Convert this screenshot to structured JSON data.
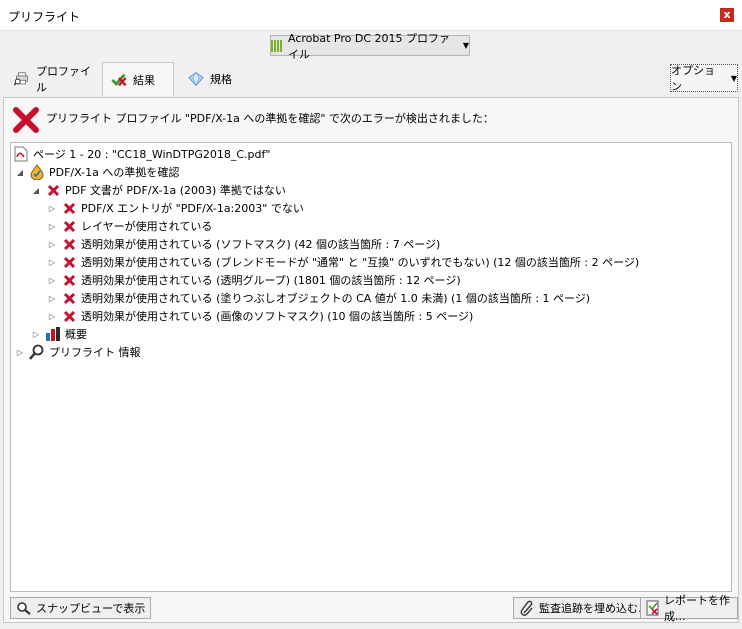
{
  "window": {
    "title": "プリフライト",
    "close_label": "x"
  },
  "profile_dropdown": {
    "label": "Acrobat Pro DC 2015 プロファイル",
    "accent": "#7cb030"
  },
  "tabs": [
    {
      "label": "プロファイル",
      "icon": "printer-magnifier-icon"
    },
    {
      "label": "結果",
      "icon": "check-cross-icon"
    },
    {
      "label": "規格",
      "icon": "diamond-icon"
    }
  ],
  "options": {
    "label": "オプション"
  },
  "message": {
    "text": "プリフライト プロファイル \"PDF/X-1a への準拠を確認\" で次のエラーが検出されました："
  },
  "tree": [
    {
      "label": "ページ 1 - 20 : \"CC18_WinDTPG2018_C.pdf\"",
      "icon": "pdf-file-icon"
    },
    {
      "label": "PDF/X-1a への準拠を確認",
      "icon": "preflight-droplet-icon"
    },
    {
      "label": "PDF 文書が PDF/X-1a (2003) 準拠ではない",
      "icon": "error-x-icon"
    },
    {
      "label": "PDF/X エントリが \"PDF/X-1a:2003\" でない",
      "icon": "error-x-icon"
    },
    {
      "label": "レイヤーが使用されている",
      "icon": "error-x-icon"
    },
    {
      "label": "透明効果が使用されている (ソフトマスク) (42 個の該当箇所 : 7 ページ)",
      "icon": "error-x-icon"
    },
    {
      "label": "透明効果が使用されている (ブレンドモードが \"通常\" と \"互換\" のいずれでもない) (12 個の該当箇所 : 2 ページ)",
      "icon": "error-x-icon"
    },
    {
      "label": "透明効果が使用されている (透明グループ) (1801 個の該当箇所 : 12 ページ)",
      "icon": "error-x-icon"
    },
    {
      "label": "透明効果が使用されている (塗りつぶしオブジェクトの CA 値が 1.0 未満) (1 個の該当箇所 : 1 ページ)",
      "icon": "error-x-icon"
    },
    {
      "label": "透明効果が使用されている (画像のソフトマスク) (10 個の該当箇所 : 5 ページ)",
      "icon": "error-x-icon"
    },
    {
      "label": "概要",
      "icon": "bar-chart-icon"
    },
    {
      "label": "プリフライト 情報",
      "icon": "magnifier-icon"
    }
  ],
  "footer": {
    "snap_label": "スナップビューで表示",
    "embed_label": "監査追跡を埋め込む...",
    "report_label": "レポートを作成..."
  },
  "colors": {
    "error": "#c8102e",
    "check": "#3a9b2a"
  }
}
